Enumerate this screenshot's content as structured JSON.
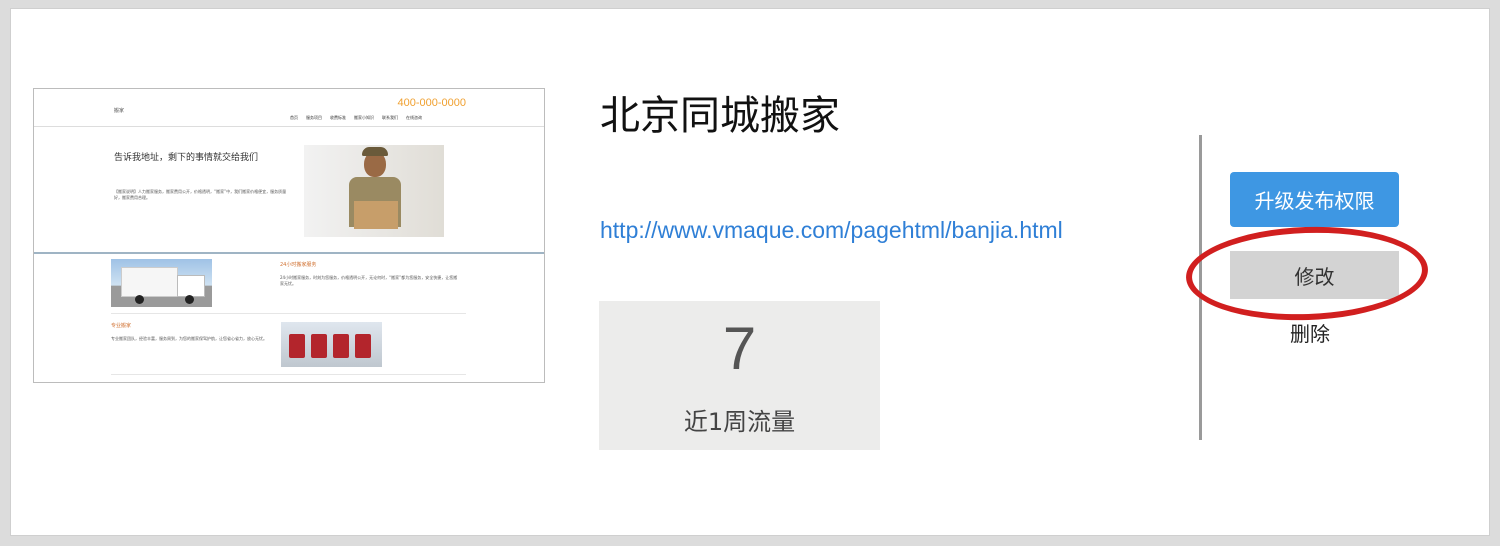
{
  "item": {
    "title": "北京同城搬家",
    "url": "http://www.vmaque.com/pagehtml/banjia.html",
    "stats": {
      "value": "7",
      "label": "近1周流量"
    }
  },
  "actions": {
    "upgrade_label": "升级发布权限",
    "edit_label": "修改",
    "delete_label": "删除"
  },
  "thumbnail": {
    "logo": "搬家",
    "phone": "400-000-0000",
    "nav": [
      "首页",
      "服务项目",
      "收费标准",
      "搬家小知识",
      "联系我们",
      "在线咨询"
    ],
    "headline": "告诉我地址，剩下的事情就交给我们",
    "paragraph": "【搬家说明】人力搬家服务，搬家费用公开，价格透明，“搬家”中，我们搬家价格便宜，服务质量好，搬家费用合理。",
    "section1_title": "24小时搬家服务",
    "section1_text": "24小时搬家服务，时刻为您服务，价格透明公开，无论何时，“搬家”都为您服务，安全快捷，让您搬家无忧。",
    "section2_title": "专业搬家",
    "section2_text": "专业搬家团队，经验丰富，服务周到，为您的搬家保驾护航，让您省心省力，放心无忧。"
  },
  "colors": {
    "accent_blue": "#3e97e3",
    "link_blue": "#2f7fd6",
    "highlight_red": "#d11f1f",
    "stat_bg": "#ececeb"
  },
  "icons": [
    "truck-image",
    "delivery-person-image",
    "fleet-image"
  ]
}
